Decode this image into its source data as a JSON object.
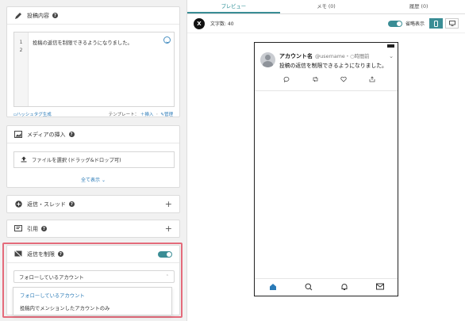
{
  "post": {
    "title": "投稿内容",
    "line_numbers": [
      "1",
      "2"
    ],
    "text": "投稿の返信を制限できるようになりました。",
    "hashtag_link": "ハッシュタグ生成",
    "template_label": "テンプレート：",
    "template_insert": "＋挿入",
    "template_separator": "・",
    "template_manage": "管理"
  },
  "media": {
    "title": "メディアの挿入",
    "file_button": "ファイルを選択 (ドラッグ&ドロップ可)",
    "show_all": "全て表示"
  },
  "thread": {
    "title": "返信・スレッド"
  },
  "quote": {
    "title": "引用"
  },
  "reply_limit": {
    "title": "返信を制限",
    "selected": "フォローしているアカウント",
    "options": [
      "フォローしているアカウント",
      "投稿内でメンションしたアカウントのみ"
    ]
  },
  "preview": {
    "tabs": [
      "プレビュー",
      "メモ (0)",
      "履歴 (0)"
    ],
    "char_count": "文字数: 40",
    "compact_label": "省略表示",
    "x_logo": "X",
    "account_name": "アカウント名",
    "meta": "@username・○時間前",
    "tweet_text": "投稿の返信を制限できるようになりました。"
  },
  "colors": {
    "accent": "#3a8d95",
    "link": "#2a7ab7",
    "highlight": "#e46b7b"
  }
}
